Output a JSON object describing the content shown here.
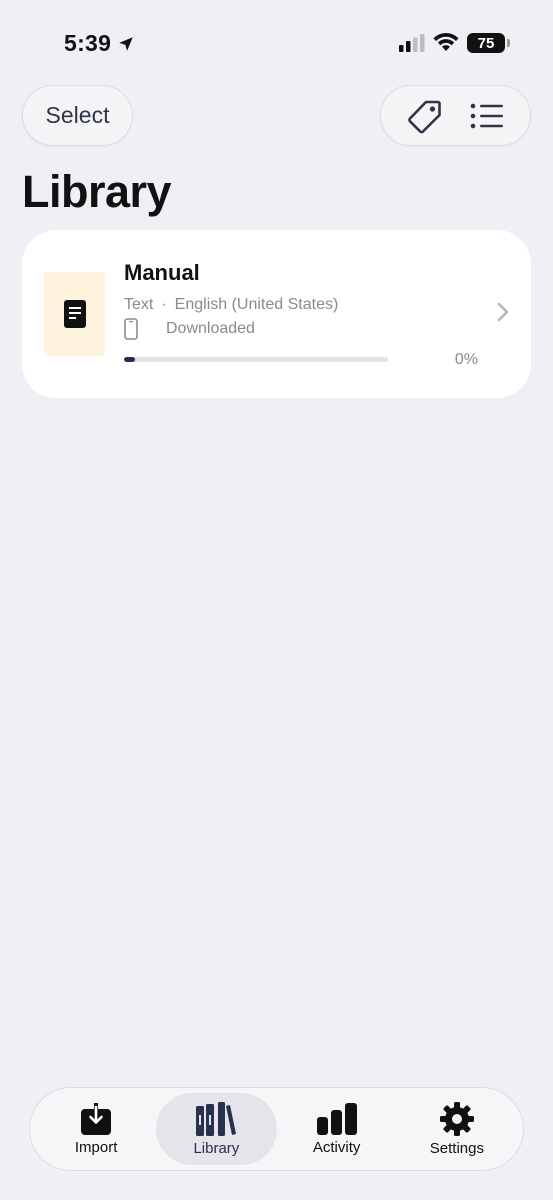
{
  "status": {
    "time": "5:39",
    "battery": "75"
  },
  "header": {
    "select_label": "Select",
    "title": "Library"
  },
  "items": [
    {
      "title": "Manual",
      "type": "Text",
      "separator": "·",
      "language": "English (United States)",
      "status": "Downloaded",
      "progress_label": "0%",
      "progress_fraction": 0.04
    }
  ],
  "tabs": [
    {
      "label": "Import",
      "icon": "import-icon"
    },
    {
      "label": "Library",
      "icon": "library-icon",
      "active": true
    },
    {
      "label": "Activity",
      "icon": "activity-icon"
    },
    {
      "label": "Settings",
      "icon": "gear-icon"
    }
  ],
  "colors": {
    "accent": "#262c4a",
    "thumb_bg": "#fdf3dc",
    "background": "#f0eff5"
  }
}
